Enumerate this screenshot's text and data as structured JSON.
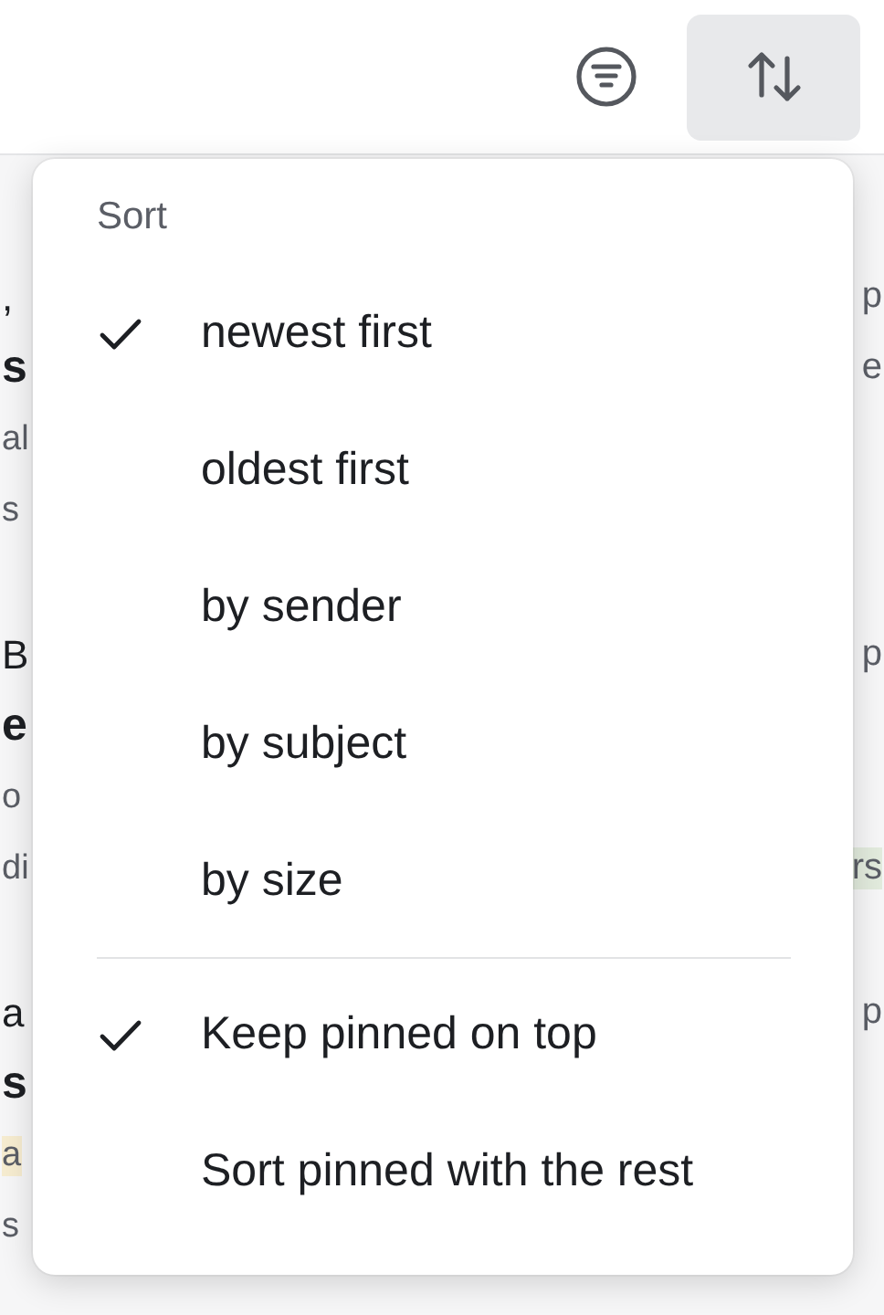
{
  "toolbar": {
    "filter_button": {
      "selected": false
    },
    "sort_button": {
      "selected": true
    }
  },
  "messages": [
    {
      "lines": [
        {
          "kind": "sender",
          "left": {
            "text": ","
          },
          "right": {
            "text": "p"
          }
        },
        {
          "kind": "subject",
          "left": {
            "text": "s"
          },
          "right": {
            "text": "e"
          }
        },
        {
          "kind": "preview",
          "left": {
            "text": "al"
          }
        },
        {
          "kind": "preview",
          "left": {
            "text": "s"
          }
        }
      ]
    },
    {
      "lines": [
        {
          "kind": "sender",
          "left": {
            "text": "B"
          },
          "right": {
            "text": "p"
          }
        },
        {
          "kind": "subject",
          "left": {
            "text": "e"
          }
        },
        {
          "kind": "preview",
          "left": {
            "text": "o"
          }
        },
        {
          "kind": "preview",
          "left": {
            "text": "di"
          },
          "right": {
            "text": "rs",
            "color": "#e2ebdd"
          }
        }
      ]
    },
    {
      "lines": [
        {
          "kind": "sender",
          "left": {
            "text": "a"
          },
          "right": {
            "text": "p"
          }
        },
        {
          "kind": "subject",
          "left": {
            "text": "s"
          }
        },
        {
          "kind": "preview",
          "left": {
            "text": "a",
            "color": "#f6ecd0"
          }
        },
        {
          "kind": "preview",
          "left": {
            "text": "s"
          }
        }
      ]
    }
  ],
  "sort_menu": {
    "title": "Sort",
    "groups": [
      [
        {
          "label": "newest first",
          "checked": true
        },
        {
          "label": "oldest first",
          "checked": false
        },
        {
          "label": "by sender",
          "checked": false
        },
        {
          "label": "by subject",
          "checked": false
        },
        {
          "label": "by size",
          "checked": false
        }
      ],
      [
        {
          "label": "Keep pinned on top",
          "checked": true
        },
        {
          "label": "Sort pinned with the rest",
          "checked": false
        }
      ]
    ]
  }
}
